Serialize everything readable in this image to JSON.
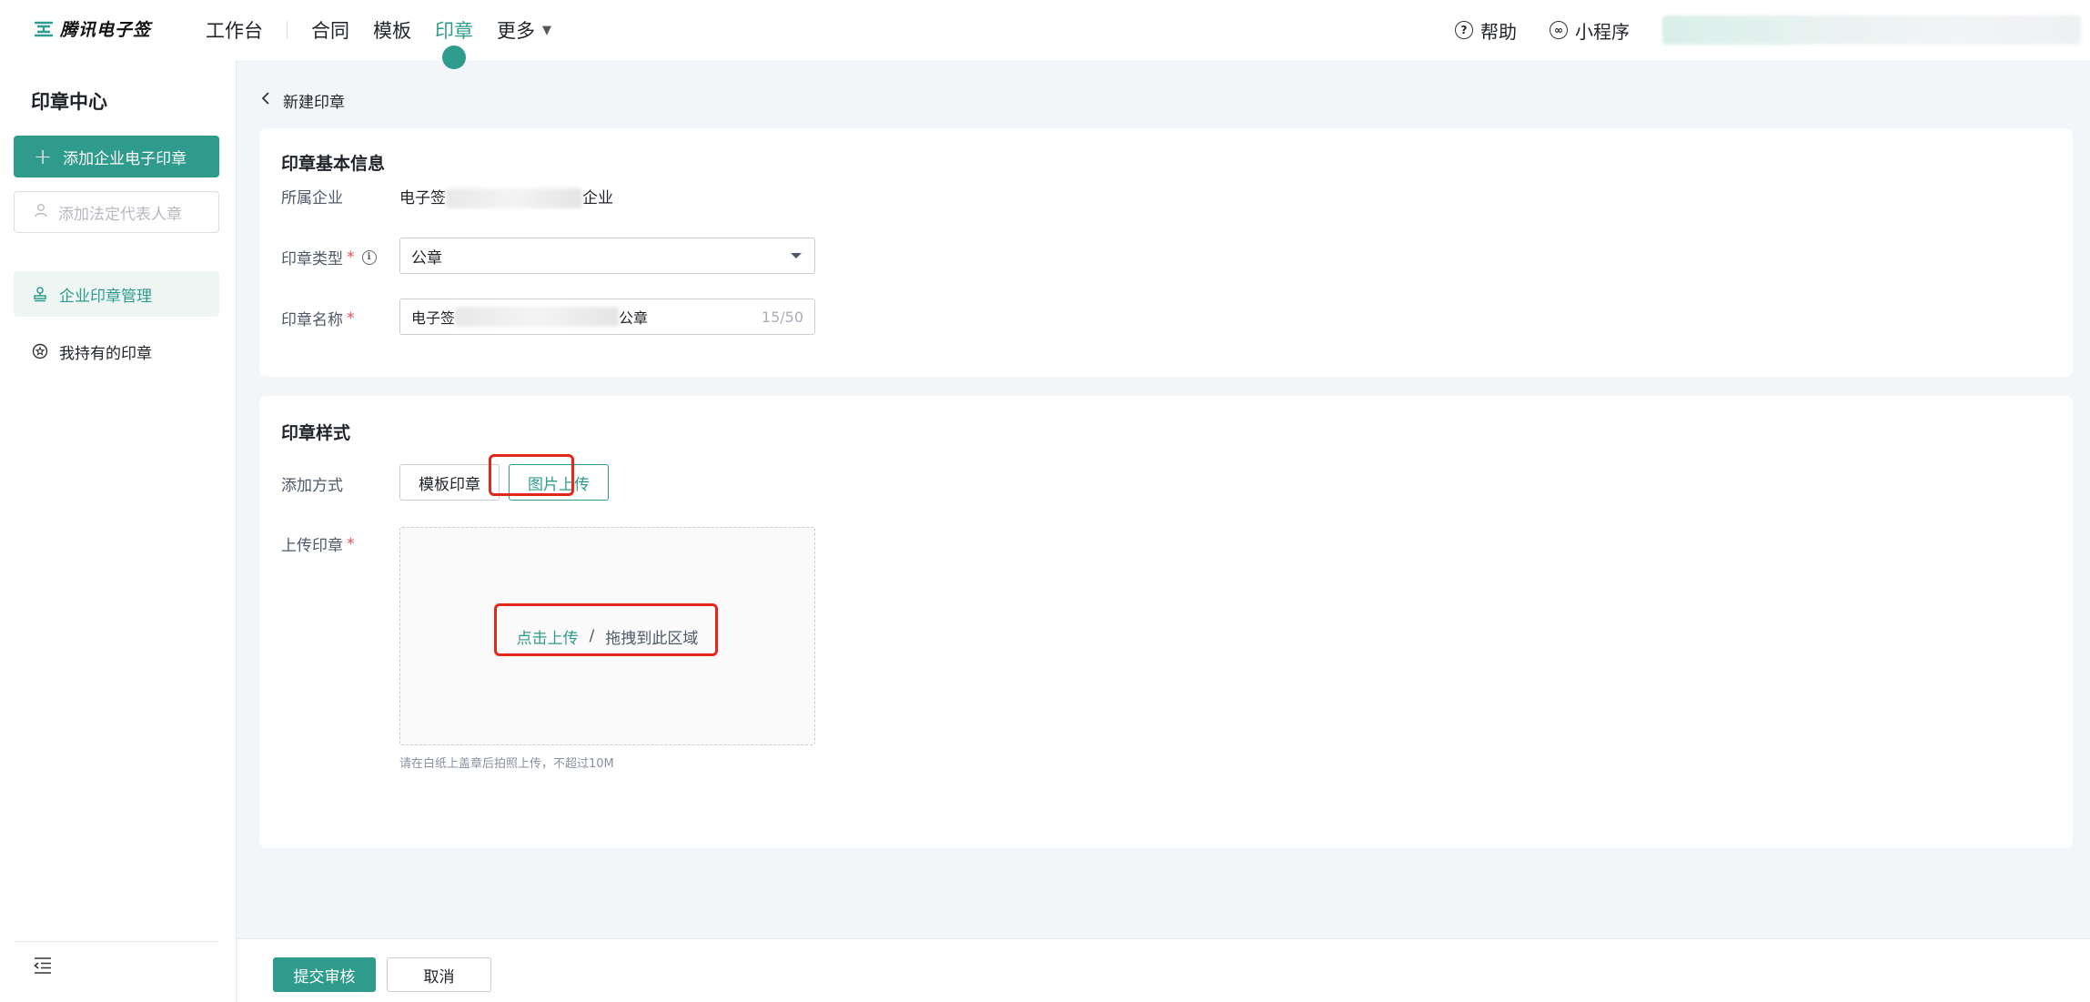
{
  "app": {
    "logo_text": "腾讯电子签",
    "brand_color": "#2e9b8c"
  },
  "nav": {
    "workbench": "工作台",
    "contract": "合同",
    "template": "模板",
    "seal": "印章",
    "more": "更多"
  },
  "top_right": {
    "help": "帮助",
    "mini_program": "小程序"
  },
  "sidebar": {
    "title": "印章中心",
    "add_enterprise_seal": "添加企业电子印章",
    "add_legal_rep_seal": "添加法定代表人章",
    "items": [
      {
        "label": "企业印章管理",
        "icon": "stamp-icon",
        "active": true
      },
      {
        "label": "我持有的印章",
        "icon": "badge-icon",
        "active": false
      }
    ]
  },
  "page": {
    "back_label": "新建印章"
  },
  "basic_info": {
    "title": "印章基本信息",
    "company_label": "所属企业",
    "company_value_prefix": "电子签",
    "company_value_suffix": "企业",
    "seal_type_label": "印章类型",
    "seal_type_value": "公章",
    "seal_name_label": "印章名称",
    "seal_name_prefix": "电子签",
    "seal_name_suffix": "公章",
    "seal_name_count": "15/50"
  },
  "seal_style": {
    "title": "印章样式",
    "add_method_label": "添加方式",
    "method_template": "模板印章",
    "method_upload": "图片上传",
    "upload_label": "上传印章",
    "upload_click": "点击上传",
    "upload_separator": "/",
    "upload_drag": "拖拽到此区域",
    "upload_hint": "请在白纸上盖章后拍照上传，不超过10M"
  },
  "footer": {
    "submit": "提交审核",
    "cancel": "取消"
  }
}
